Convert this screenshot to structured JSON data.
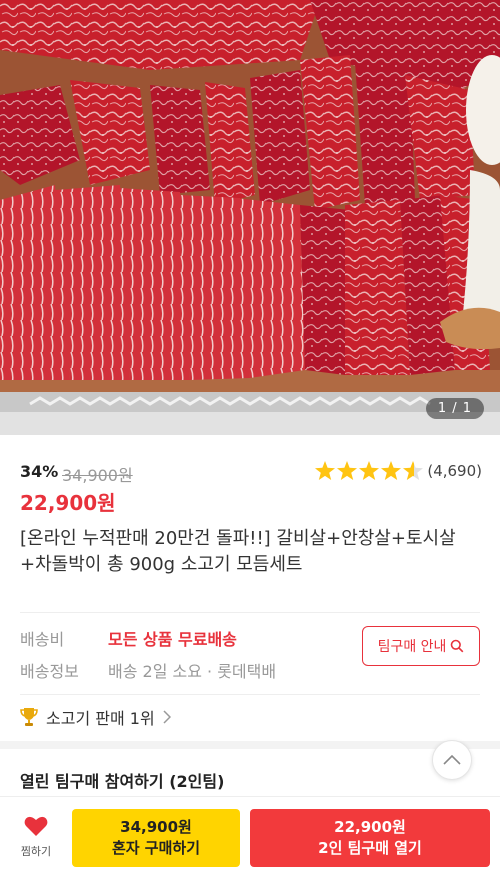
{
  "hero": {
    "image_icon": "beef-platter-photo",
    "page_indicator": "1 / 1"
  },
  "price": {
    "discount": "34%",
    "original": "34,900원",
    "sale": "22,900원",
    "rating": 4.5,
    "review_count": "(4,690)",
    "accent_color": "#e8323c",
    "star_color": "#ffc412"
  },
  "product": {
    "title": "[온라인 누적판매 20만건 돌파!!] 갈비살+안창살+토시살+차돌박이 총 900g 소고기 모듬세트"
  },
  "shipping": {
    "fee_label": "배송비",
    "fee_value": "모든 상품 무료배송",
    "info_label": "배송정보",
    "info_value": "배송 2일 소요 · 롯데택배",
    "team_guide_button": "팀구매 안내"
  },
  "rank": {
    "icon": "trophy-icon",
    "text": "소고기 판매 1위"
  },
  "team": {
    "open_team_text": "열린 팀구매 참여하기 (2인팀)"
  },
  "bottom_bar": {
    "wish_label": "찜하기",
    "solo_price": "34,900원",
    "solo_label": "혼자 구매하기",
    "team_price": "22,900원",
    "team_label": "2인 팀구매 열기"
  }
}
